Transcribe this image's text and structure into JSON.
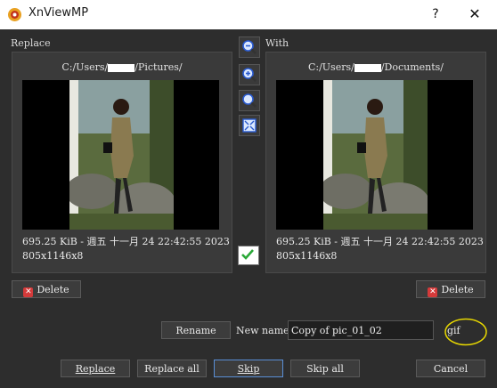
{
  "window": {
    "title": "XnViewMP",
    "help_symbol": "?",
    "close_symbol": "✕"
  },
  "left": {
    "section_label": "Replace",
    "path_prefix": "C:/Users/",
    "path_suffix": "/Pictures/",
    "size_date": "695.25 KiB - 週五 十一月 24 22:42:55 2023",
    "dimensions": "805x1146x8",
    "delete_label": "Delete"
  },
  "right": {
    "section_label": "With",
    "path_prefix": "C:/Users/",
    "path_suffix": "/Documents/",
    "size_date": "695.25 KiB - 週五 十一月 24 22:42:55 2023",
    "dimensions": "805x1146x8",
    "delete_label": "Delete"
  },
  "zoom_tools": [
    "zoom-out-icon",
    "zoom-in-icon",
    "zoom-actual-icon",
    "fit-window-icon"
  ],
  "rename": {
    "button_label": "Rename",
    "new_name_label": "New name:",
    "new_name_value": "Copy of pic_01_02",
    "extension": "gif"
  },
  "actions": {
    "replace": "Replace",
    "replace_all": "Replace all",
    "skip": "Skip",
    "skip_all": "Skip all",
    "cancel": "Cancel"
  },
  "colors": {
    "background": "#2d2d2d",
    "panel": "#3a3a3a",
    "delete_icon": "#d43a3a",
    "highlight_circle": "#e8d800",
    "focus_border": "#5a8fd6"
  }
}
